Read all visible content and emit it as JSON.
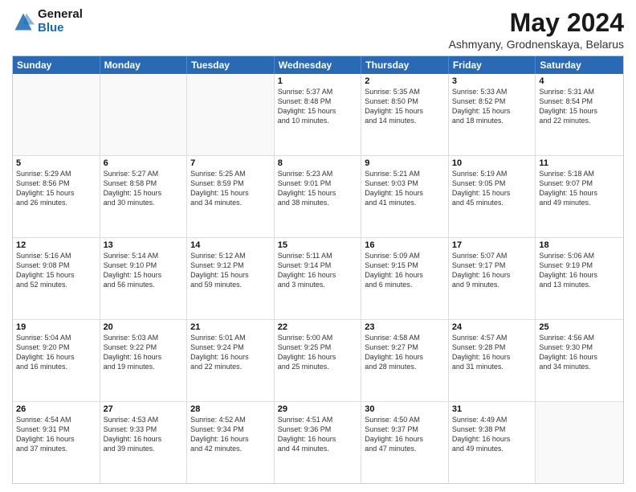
{
  "header": {
    "logo_general": "General",
    "logo_blue": "Blue",
    "month_title": "May 2024",
    "location": "Ashmyany, Grodnenskaya, Belarus"
  },
  "calendar": {
    "days_of_week": [
      "Sunday",
      "Monday",
      "Tuesday",
      "Wednesday",
      "Thursday",
      "Friday",
      "Saturday"
    ],
    "rows": [
      [
        {
          "day": "",
          "info": "",
          "empty": true
        },
        {
          "day": "",
          "info": "",
          "empty": true
        },
        {
          "day": "",
          "info": "",
          "empty": true
        },
        {
          "day": "1",
          "info": "Sunrise: 5:37 AM\nSunset: 8:48 PM\nDaylight: 15 hours\nand 10 minutes.",
          "empty": false
        },
        {
          "day": "2",
          "info": "Sunrise: 5:35 AM\nSunset: 8:50 PM\nDaylight: 15 hours\nand 14 minutes.",
          "empty": false
        },
        {
          "day": "3",
          "info": "Sunrise: 5:33 AM\nSunset: 8:52 PM\nDaylight: 15 hours\nand 18 minutes.",
          "empty": false
        },
        {
          "day": "4",
          "info": "Sunrise: 5:31 AM\nSunset: 8:54 PM\nDaylight: 15 hours\nand 22 minutes.",
          "empty": false
        }
      ],
      [
        {
          "day": "5",
          "info": "Sunrise: 5:29 AM\nSunset: 8:56 PM\nDaylight: 15 hours\nand 26 minutes.",
          "empty": false
        },
        {
          "day": "6",
          "info": "Sunrise: 5:27 AM\nSunset: 8:58 PM\nDaylight: 15 hours\nand 30 minutes.",
          "empty": false
        },
        {
          "day": "7",
          "info": "Sunrise: 5:25 AM\nSunset: 8:59 PM\nDaylight: 15 hours\nand 34 minutes.",
          "empty": false
        },
        {
          "day": "8",
          "info": "Sunrise: 5:23 AM\nSunset: 9:01 PM\nDaylight: 15 hours\nand 38 minutes.",
          "empty": false
        },
        {
          "day": "9",
          "info": "Sunrise: 5:21 AM\nSunset: 9:03 PM\nDaylight: 15 hours\nand 41 minutes.",
          "empty": false
        },
        {
          "day": "10",
          "info": "Sunrise: 5:19 AM\nSunset: 9:05 PM\nDaylight: 15 hours\nand 45 minutes.",
          "empty": false
        },
        {
          "day": "11",
          "info": "Sunrise: 5:18 AM\nSunset: 9:07 PM\nDaylight: 15 hours\nand 49 minutes.",
          "empty": false
        }
      ],
      [
        {
          "day": "12",
          "info": "Sunrise: 5:16 AM\nSunset: 9:08 PM\nDaylight: 15 hours\nand 52 minutes.",
          "empty": false
        },
        {
          "day": "13",
          "info": "Sunrise: 5:14 AM\nSunset: 9:10 PM\nDaylight: 15 hours\nand 56 minutes.",
          "empty": false
        },
        {
          "day": "14",
          "info": "Sunrise: 5:12 AM\nSunset: 9:12 PM\nDaylight: 15 hours\nand 59 minutes.",
          "empty": false
        },
        {
          "day": "15",
          "info": "Sunrise: 5:11 AM\nSunset: 9:14 PM\nDaylight: 16 hours\nand 3 minutes.",
          "empty": false
        },
        {
          "day": "16",
          "info": "Sunrise: 5:09 AM\nSunset: 9:15 PM\nDaylight: 16 hours\nand 6 minutes.",
          "empty": false
        },
        {
          "day": "17",
          "info": "Sunrise: 5:07 AM\nSunset: 9:17 PM\nDaylight: 16 hours\nand 9 minutes.",
          "empty": false
        },
        {
          "day": "18",
          "info": "Sunrise: 5:06 AM\nSunset: 9:19 PM\nDaylight: 16 hours\nand 13 minutes.",
          "empty": false
        }
      ],
      [
        {
          "day": "19",
          "info": "Sunrise: 5:04 AM\nSunset: 9:20 PM\nDaylight: 16 hours\nand 16 minutes.",
          "empty": false
        },
        {
          "day": "20",
          "info": "Sunrise: 5:03 AM\nSunset: 9:22 PM\nDaylight: 16 hours\nand 19 minutes.",
          "empty": false
        },
        {
          "day": "21",
          "info": "Sunrise: 5:01 AM\nSunset: 9:24 PM\nDaylight: 16 hours\nand 22 minutes.",
          "empty": false
        },
        {
          "day": "22",
          "info": "Sunrise: 5:00 AM\nSunset: 9:25 PM\nDaylight: 16 hours\nand 25 minutes.",
          "empty": false
        },
        {
          "day": "23",
          "info": "Sunrise: 4:58 AM\nSunset: 9:27 PM\nDaylight: 16 hours\nand 28 minutes.",
          "empty": false
        },
        {
          "day": "24",
          "info": "Sunrise: 4:57 AM\nSunset: 9:28 PM\nDaylight: 16 hours\nand 31 minutes.",
          "empty": false
        },
        {
          "day": "25",
          "info": "Sunrise: 4:56 AM\nSunset: 9:30 PM\nDaylight: 16 hours\nand 34 minutes.",
          "empty": false
        }
      ],
      [
        {
          "day": "26",
          "info": "Sunrise: 4:54 AM\nSunset: 9:31 PM\nDaylight: 16 hours\nand 37 minutes.",
          "empty": false
        },
        {
          "day": "27",
          "info": "Sunrise: 4:53 AM\nSunset: 9:33 PM\nDaylight: 16 hours\nand 39 minutes.",
          "empty": false
        },
        {
          "day": "28",
          "info": "Sunrise: 4:52 AM\nSunset: 9:34 PM\nDaylight: 16 hours\nand 42 minutes.",
          "empty": false
        },
        {
          "day": "29",
          "info": "Sunrise: 4:51 AM\nSunset: 9:36 PM\nDaylight: 16 hours\nand 44 minutes.",
          "empty": false
        },
        {
          "day": "30",
          "info": "Sunrise: 4:50 AM\nSunset: 9:37 PM\nDaylight: 16 hours\nand 47 minutes.",
          "empty": false
        },
        {
          "day": "31",
          "info": "Sunrise: 4:49 AM\nSunset: 9:38 PM\nDaylight: 16 hours\nand 49 minutes.",
          "empty": false
        },
        {
          "day": "",
          "info": "",
          "empty": true
        }
      ]
    ]
  }
}
